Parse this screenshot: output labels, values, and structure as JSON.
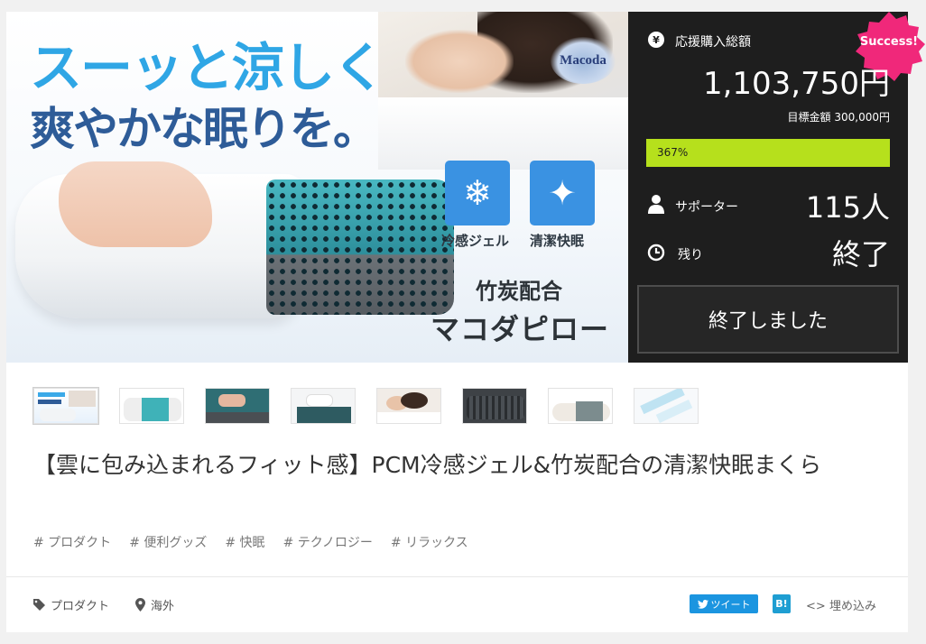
{
  "hero": {
    "headline_line1": "スーッと涼しく",
    "headline_line2": "爽やかな眠りを。",
    "logo": "Macoda",
    "feature1_label": "冷感ジェル",
    "feature2_label": "清潔快眠",
    "feature1_icon": "snowflake-icon",
    "feature2_icon": "sparkle-icon",
    "tagline1": "竹炭配合",
    "tagline2": "マコダピロー"
  },
  "panel": {
    "badge": "Success!",
    "total_label": "応援購入総額",
    "total_amount": "1,103,750円",
    "goal": "目標金額 300,000円",
    "progress_text": "367%",
    "progress_fraction": 1.0,
    "supporters_label": "サポーター",
    "supporters_value": "115人",
    "remaining_label": "残り",
    "remaining_value": "終了",
    "ended_button": "終了しました",
    "accent_color": "#b6e01c",
    "badge_color": "#f0287a"
  },
  "thumbnails": [
    {
      "name": "thumb-headline"
    },
    {
      "name": "thumb-gel-pillow"
    },
    {
      "name": "thumb-hand-press"
    },
    {
      "name": "thumb-pillow-side"
    },
    {
      "name": "thumb-sleeping"
    },
    {
      "name": "thumb-charcoal"
    },
    {
      "name": "thumb-pillow-angle"
    },
    {
      "name": "thumb-detail"
    }
  ],
  "title": "【雲に包み込まれるフィット感】PCM冷感ジェル&竹炭配合の清潔快眠まくら",
  "tags": [
    "# プロダクト",
    "# 便利グッズ",
    "# 快眠",
    "# テクノロジー",
    "# リラックス"
  ],
  "footer": {
    "category": "プロダクト",
    "location": "海外",
    "tweet": "ツイート",
    "hatena": "B!",
    "embed": "埋め込み"
  }
}
